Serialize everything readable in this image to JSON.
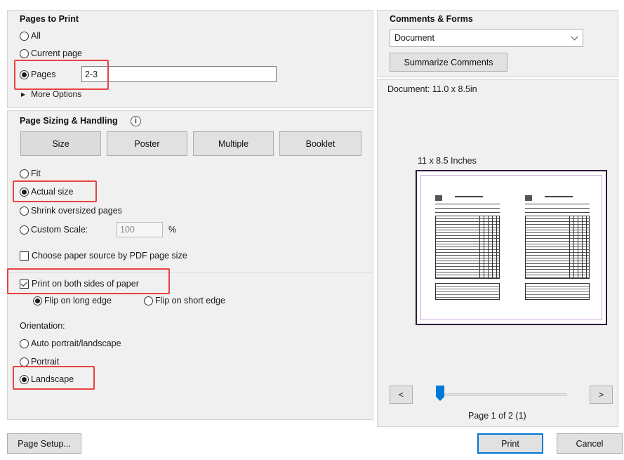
{
  "pages_to_print": {
    "title": "Pages to Print",
    "all": "All",
    "current_page": "Current page",
    "pages": "Pages",
    "pages_value": "2-3",
    "more_options": "More Options"
  },
  "page_sizing": {
    "title": "Page Sizing & Handling",
    "tabs": [
      "Size",
      "Poster",
      "Multiple",
      "Booklet"
    ],
    "fit": "Fit",
    "actual_size": "Actual size",
    "shrink": "Shrink oversized pages",
    "custom_scale": "Custom Scale:",
    "custom_scale_value": "100",
    "percent": "%",
    "paper_source": "Choose paper source by PDF page size"
  },
  "duplex": {
    "both_sides": "Print on both sides of paper",
    "long_edge": "Flip on long edge",
    "short_edge": "Flip on short edge"
  },
  "orientation": {
    "title": "Orientation:",
    "auto": "Auto portrait/landscape",
    "portrait": "Portrait",
    "landscape": "Landscape"
  },
  "comments_forms": {
    "title": "Comments & Forms",
    "select_value": "Document",
    "summarize": "Summarize Comments"
  },
  "preview": {
    "document_size": "Document: 11.0 x 8.5in",
    "paper_label": "11 x 8.5 Inches",
    "page_status": "Page 1 of 2 (1)",
    "prev": "<",
    "next": ">"
  },
  "footer": {
    "page_setup": "Page Setup...",
    "print": "Print",
    "cancel": "Cancel"
  },
  "colors": {
    "highlight": "#e8423f",
    "accent": "#0078d7"
  }
}
